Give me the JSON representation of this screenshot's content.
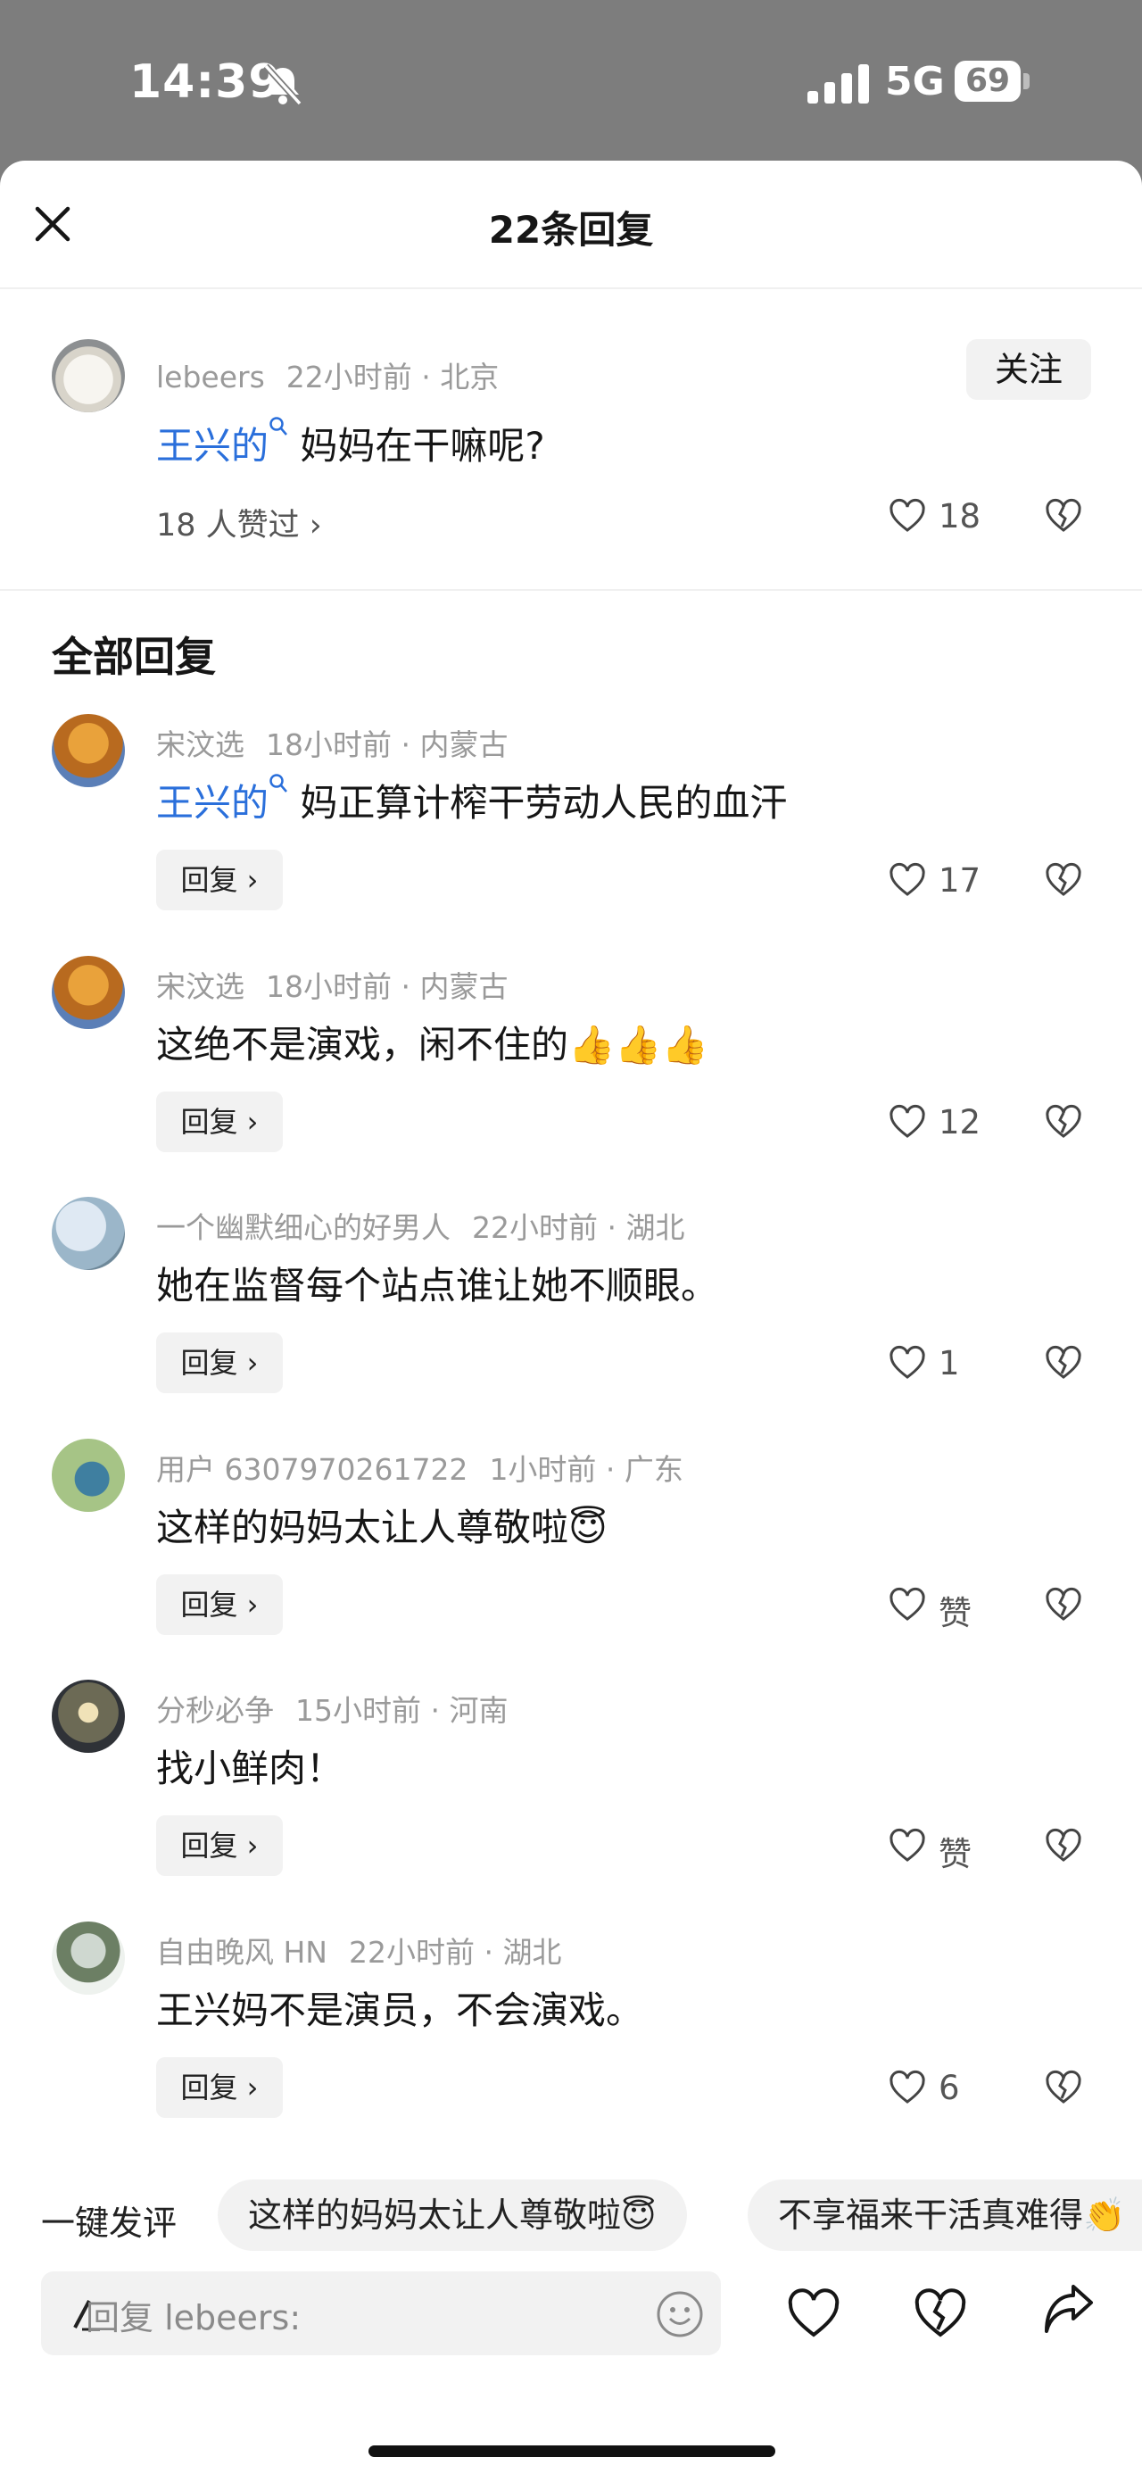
{
  "status_bar": {
    "time": "14:39",
    "network": "5G",
    "battery": "69"
  },
  "sheet": {
    "title": "22条回复",
    "follow_label": "关注"
  },
  "root_comment": {
    "user": "lebeers",
    "time": "22小时前",
    "location": "北京",
    "mention": "王兴的",
    "text": "妈妈在干嘛呢?",
    "likers": "18 人赞过 ›",
    "like_count": "18"
  },
  "section_title": "全部回复",
  "reply_label": "回复 ›",
  "replies": [
    {
      "user": "宋汶选",
      "time": "18小时前",
      "location": "内蒙古",
      "mention": "王兴的",
      "text": "妈正算计榨干劳动人民的血汗",
      "like_count": "17"
    },
    {
      "user": "宋汶选",
      "time": "18小时前",
      "location": "内蒙古",
      "mention": "",
      "text": "这绝不是演戏，闲不住的👍👍👍",
      "like_count": "12"
    },
    {
      "user": "一个幽默细心的好男人",
      "time": "22小时前",
      "location": "湖北",
      "mention": "",
      "text": "她在监督每个站点谁让她不顺眼。",
      "like_count": "1"
    },
    {
      "user": "用户 6307970261722",
      "time": "1小时前",
      "location": "广东",
      "mention": "",
      "text": "这样的妈妈太让人尊敬啦😇",
      "like_count": "赞"
    },
    {
      "user": "分秒必争",
      "time": "15小时前",
      "location": "河南",
      "mention": "",
      "text": "找小鲜肉！",
      "like_count": "赞"
    },
    {
      "user": "自由晚风 HN",
      "time": "22小时前",
      "location": "湖北",
      "mention": "",
      "text": "王兴妈不是演员，不会演戏。",
      "like_count": "6"
    }
  ],
  "quick_reply": {
    "label": "一键发评",
    "chips": [
      "这样的妈妈太让人尊敬啦😇",
      "不享福来干活真难得👏"
    ]
  },
  "input": {
    "placeholder": "回复 lebeers:"
  },
  "icons": [
    "bell-muted-icon",
    "signal-icon",
    "battery-icon",
    "close-icon",
    "search-icon",
    "heart-icon",
    "broken-heart-icon",
    "pen-icon",
    "emoji-icon",
    "share-icon"
  ],
  "colors": {
    "link": "#2a6fdb",
    "meta": "#9a9a9a",
    "chip_bg": "#f2f2f2"
  }
}
